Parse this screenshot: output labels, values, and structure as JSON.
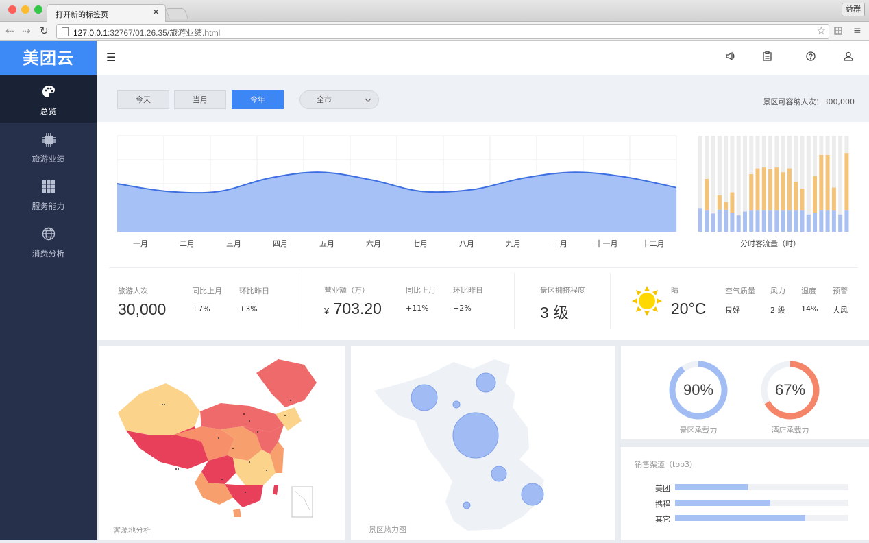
{
  "browser": {
    "tab_title": "打开新的标签页",
    "url_host": "127.0.0.1",
    "url_rest": ":32767/01.26.35/旅游业绩.html",
    "user": "益群"
  },
  "sidebar": {
    "logo": "美团云",
    "items": [
      {
        "label": "总览",
        "icon": "palette-icon",
        "active": true
      },
      {
        "label": "旅游业绩",
        "icon": "chip-icon",
        "active": false
      },
      {
        "label": "服务能力",
        "icon": "grid-icon",
        "active": false
      },
      {
        "label": "消费分析",
        "icon": "globe-icon",
        "active": false
      }
    ]
  },
  "filters": {
    "buttons": [
      "今天",
      "当月",
      "今年"
    ],
    "active_index": 2,
    "region": "全市",
    "capacity_text": "景区可容纳人次：300,000"
  },
  "area_chart_months": [
    "一月",
    "二月",
    "三月",
    "四月",
    "五月",
    "六月",
    "七月",
    "八月",
    "九月",
    "十月",
    "十一月",
    "十二月"
  ],
  "chart_data": [
    {
      "type": "area",
      "categories": [
        "一月",
        "二月",
        "三月",
        "四月",
        "五月",
        "六月",
        "七月",
        "八月",
        "九月",
        "十月",
        "十一月",
        "十二月"
      ],
      "values": [
        50,
        42,
        42,
        56,
        62,
        54,
        42,
        44,
        56,
        62,
        57,
        46
      ],
      "ylim": [
        0,
        100
      ],
      "grid": true,
      "color": "#3e6fe0",
      "fill": "#a5c1f5"
    },
    {
      "type": "bar",
      "xlabel": "分时客流量（时）",
      "stacked": true,
      "series": [
        {
          "values": [
            24,
            22,
            19,
            23,
            23,
            20,
            17,
            21,
            22,
            22,
            22,
            22,
            22,
            22,
            22,
            22,
            22,
            18,
            20,
            22,
            22,
            22,
            18,
            22
          ]
        },
        {
          "values": [
            0,
            33,
            0,
            15,
            8,
            21,
            0,
            0,
            38,
            44,
            45,
            43,
            45,
            40,
            44,
            30,
            23,
            0,
            38,
            58,
            58,
            24,
            0,
            60
          ]
        }
      ],
      "ylim": [
        0,
        100
      ],
      "colors": [
        "#a9c0f0",
        "#f4c37a",
        "#ececec"
      ]
    }
  ],
  "stats": {
    "visitors": {
      "label": "旅游人次",
      "value": "30,000",
      "mom_label": "同比上月",
      "mom": "+7%",
      "dod_label": "环比昨日",
      "dod": "+3%"
    },
    "revenue": {
      "label": "营业额（万）",
      "currency": "¥",
      "value": "703.20",
      "mom_label": "同比上月",
      "mom": "+11%",
      "dod_label": "环比昨日",
      "dod": "+2%"
    },
    "crowd": {
      "label": "景区拥挤程度",
      "value": "3 级"
    },
    "weather": {
      "cond": "晴",
      "temp": "20°C",
      "air_label": "空气质量",
      "air": "良好",
      "wind_label": "风力",
      "wind": "2 级",
      "hum_label": "湿度",
      "hum": "14%",
      "warn_label": "预警",
      "warn": "大风"
    }
  },
  "cards": {
    "map_label": "客源地分析",
    "heat_label": "景区热力图",
    "donuts": [
      {
        "value": "90%",
        "pct": 0.9,
        "label": "景区承载力",
        "color": "#a1bdf3"
      },
      {
        "value": "67%",
        "pct": 0.67,
        "label": "酒店承载力",
        "color": "#f58569"
      }
    ],
    "channels": {
      "title": "销售渠道（top3）",
      "items": [
        {
          "label": "美团",
          "pct": 0.42
        },
        {
          "label": "携程",
          "pct": 0.55
        },
        {
          "label": "其它",
          "pct": 0.75
        }
      ]
    }
  }
}
